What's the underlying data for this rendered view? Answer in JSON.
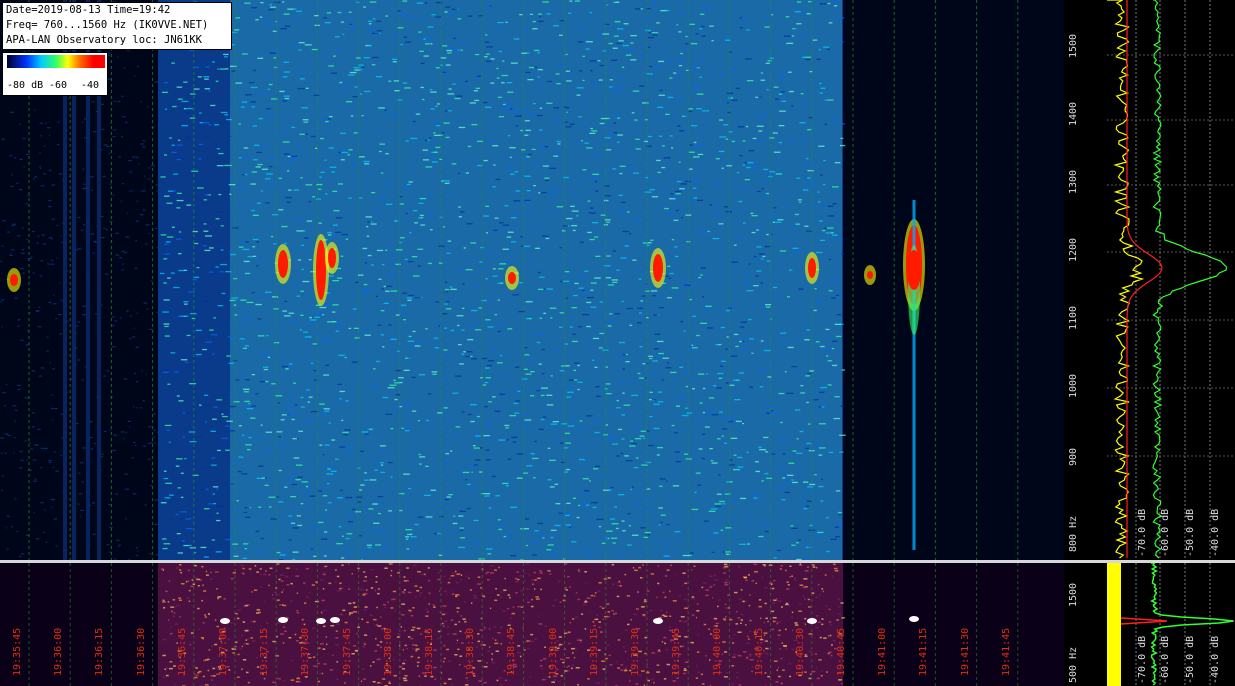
{
  "header": {
    "line1": "Date=2019-08-13 Time=19:42",
    "line2": "Freq= 760...1560 Hz (IK0VVE.NET)",
    "line3": "APA-LAN Observatory loc: JN61KK"
  },
  "legend": {
    "labels": [
      "-80 dB",
      "-60",
      "-40"
    ],
    "colors": [
      "#00002a",
      "#0033ff",
      "#00ccff",
      "#33ff66",
      "#ffff00",
      "#ff6600",
      "#ff0000"
    ]
  },
  "freq_axis_main": {
    "ticks": [
      "1500",
      "1400",
      "1300",
      "1200",
      "1100",
      "1000",
      "900",
      "800 Hz"
    ]
  },
  "freq_axis_strip": {
    "ticks": [
      "1500",
      "500 Hz"
    ]
  },
  "db_axis_main": {
    "labels": [
      "-70.0 dB",
      "-60.0 dB",
      "-50.0 dB",
      "-40.0 dB"
    ]
  },
  "db_axis_strip": {
    "labels": [
      "-70.0 dB",
      "-60.0 dB",
      "-50.0 dB",
      "-40.0 dB"
    ]
  },
  "time_axis": {
    "ticks": [
      "19:35:45",
      "19:36:00",
      "19:36:15",
      "19:36:30",
      "19:36:45",
      "19:37:00",
      "19:37:15",
      "19:37:30",
      "19:37:45",
      "19:38:00",
      "19:38:15",
      "19:38:30",
      "19:38:45",
      "19:39:00",
      "19:39:15",
      "19:39:30",
      "19:39:45",
      "19:40:00",
      "19:40:15",
      "19:40:30",
      "19:40:45",
      "19:41:00",
      "19:41:15",
      "19:41:30",
      "19:41:45"
    ]
  },
  "colors": {
    "grid": "#2a8a2a",
    "time_label": "#e03010",
    "spectrum_avg": "#ffff00",
    "spectrum_peak": "#33ff33",
    "spectrum_ref": "#ff2020"
  }
}
